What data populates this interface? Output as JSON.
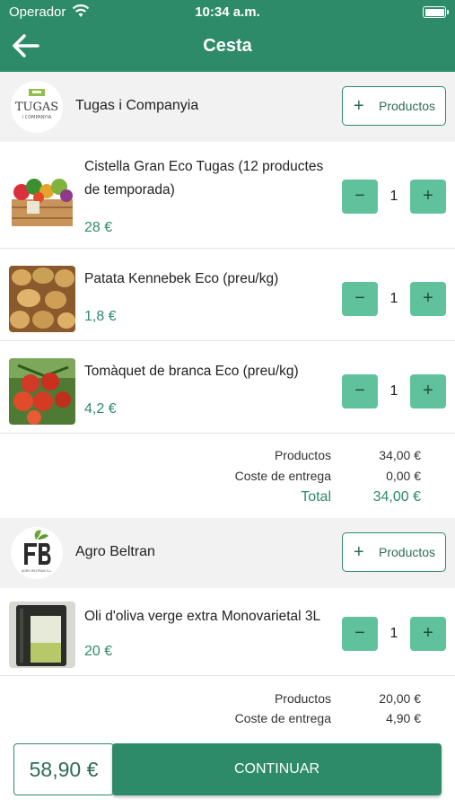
{
  "status_bar": {
    "carrier": "Operador",
    "time": "10:34 a.m."
  },
  "header": {
    "title": "Cesta",
    "back_icon": "arrow-left-icon"
  },
  "colors": {
    "primary": "#2e8b6a",
    "stepper": "#5fc29c",
    "price": "#2e8b6a"
  },
  "stores": [
    {
      "name": "Tugas i Companyia",
      "logo_text": "TUGAS",
      "logo_subtext": "i COMPANYIA",
      "add_products_label": "Productos",
      "items": [
        {
          "name": "Cistella Gran Eco Tugas (12 productes de temporada)",
          "price": "28 €",
          "quantity": "1",
          "image": "vegetable-crate"
        },
        {
          "name": "Patata Kennebek Eco (preu/kg)",
          "price": "1,8 €",
          "quantity": "1",
          "image": "potatoes"
        },
        {
          "name": "Tomàquet de branca Eco (preu/kg)",
          "price": "4,2 €",
          "quantity": "1",
          "image": "tomatoes"
        }
      ],
      "summary": {
        "products_label": "Productos",
        "products_value": "34,00 €",
        "delivery_label": "Coste de entrega",
        "delivery_value": "0,00 €",
        "total_label": "Total",
        "total_value": "34,00 €"
      }
    },
    {
      "name": "Agro Beltran",
      "logo_text": "AGRO BELTRAN S.L.",
      "add_products_label": "Productos",
      "items": [
        {
          "name": "Oli d'oliva verge extra Monovarietal 3L",
          "price": "20 €",
          "quantity": "1",
          "image": "olive-oil-can"
        }
      ],
      "summary": {
        "products_label": "Productos",
        "products_value": "20,00 €",
        "delivery_label": "Coste de entrega",
        "delivery_value": "4,90 €"
      }
    }
  ],
  "footer": {
    "grand_total": "58,90 €",
    "continue_label": "CONTINUAR"
  }
}
